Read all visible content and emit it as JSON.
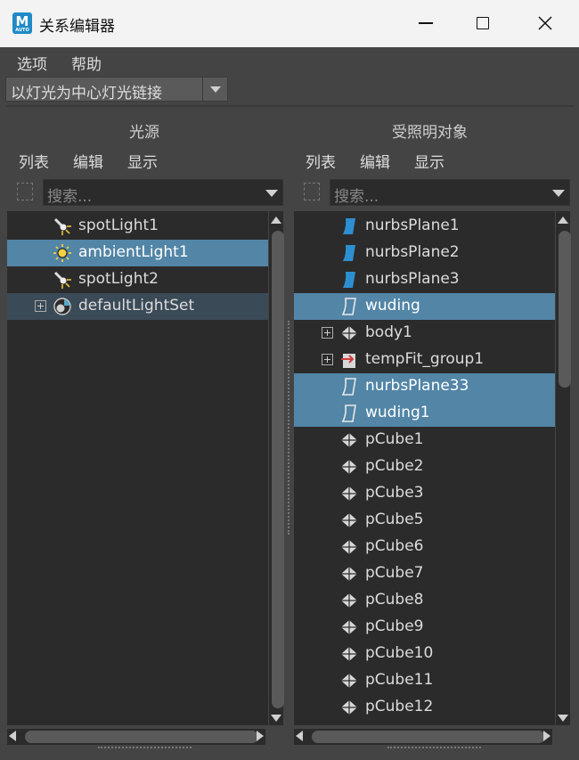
{
  "window": {
    "title": "关系编辑器",
    "app_icon_letter": "M",
    "app_icon_sub": "AUTO"
  },
  "menu": {
    "options": "选项",
    "help": "帮助"
  },
  "mode": {
    "value": "以灯光为中心灯光链接"
  },
  "left_panel": {
    "header": "光源",
    "menu": {
      "list": "列表",
      "edit": "编辑",
      "show": "显示"
    },
    "search_placeholder": "搜索...",
    "items": [
      {
        "label": "spotLight1",
        "icon": "spotlight-icon",
        "selected": false,
        "expandable": false
      },
      {
        "label": "ambientLight1",
        "icon": "ambientlight-icon",
        "selected": true,
        "expandable": false
      },
      {
        "label": "spotLight2",
        "icon": "spotlight-icon",
        "selected": false,
        "expandable": false
      },
      {
        "label": "defaultLightSet",
        "icon": "lightset-icon",
        "selected": false,
        "expandable": true
      }
    ]
  },
  "right_panel": {
    "header": "受照明对象",
    "menu": {
      "list": "列表",
      "edit": "编辑",
      "show": "显示"
    },
    "search_placeholder": "搜索...",
    "items": [
      {
        "label": "nurbsPlane1",
        "icon": "nurbs-plane-icon",
        "selected": false,
        "expandable": false
      },
      {
        "label": "nurbsPlane2",
        "icon": "nurbs-plane-icon",
        "selected": false,
        "expandable": false
      },
      {
        "label": "nurbsPlane3",
        "icon": "nurbs-plane-icon",
        "selected": false,
        "expandable": false
      },
      {
        "label": "wuding",
        "icon": "nurbs-plane-outline-icon",
        "selected": true,
        "expandable": false
      },
      {
        "label": "body1",
        "icon": "mesh-icon",
        "selected": false,
        "expandable": true
      },
      {
        "label": "tempFit_group1",
        "icon": "group-icon",
        "selected": false,
        "expandable": true
      },
      {
        "label": "nurbsPlane33",
        "icon": "nurbs-plane-outline-icon",
        "selected": true,
        "expandable": false
      },
      {
        "label": "wuding1",
        "icon": "nurbs-plane-outline-icon",
        "selected": true,
        "expandable": false
      },
      {
        "label": "pCube1",
        "icon": "mesh-icon",
        "selected": false,
        "expandable": false
      },
      {
        "label": "pCube2",
        "icon": "mesh-icon",
        "selected": false,
        "expandable": false
      },
      {
        "label": "pCube3",
        "icon": "mesh-icon",
        "selected": false,
        "expandable": false
      },
      {
        "label": "pCube5",
        "icon": "mesh-icon",
        "selected": false,
        "expandable": false
      },
      {
        "label": "pCube6",
        "icon": "mesh-icon",
        "selected": false,
        "expandable": false
      },
      {
        "label": "pCube7",
        "icon": "mesh-icon",
        "selected": false,
        "expandable": false
      },
      {
        "label": "pCube8",
        "icon": "mesh-icon",
        "selected": false,
        "expandable": false
      },
      {
        "label": "pCube9",
        "icon": "mesh-icon",
        "selected": false,
        "expandable": false
      },
      {
        "label": "pCube10",
        "icon": "mesh-icon",
        "selected": false,
        "expandable": false
      },
      {
        "label": "pCube11",
        "icon": "mesh-icon",
        "selected": false,
        "expandable": false
      },
      {
        "label": "pCube12",
        "icon": "mesh-icon",
        "selected": false,
        "expandable": false
      }
    ]
  },
  "colors": {
    "selection": "#5285a6",
    "list_bg": "#2b2b2b",
    "window_bg": "#444444"
  }
}
